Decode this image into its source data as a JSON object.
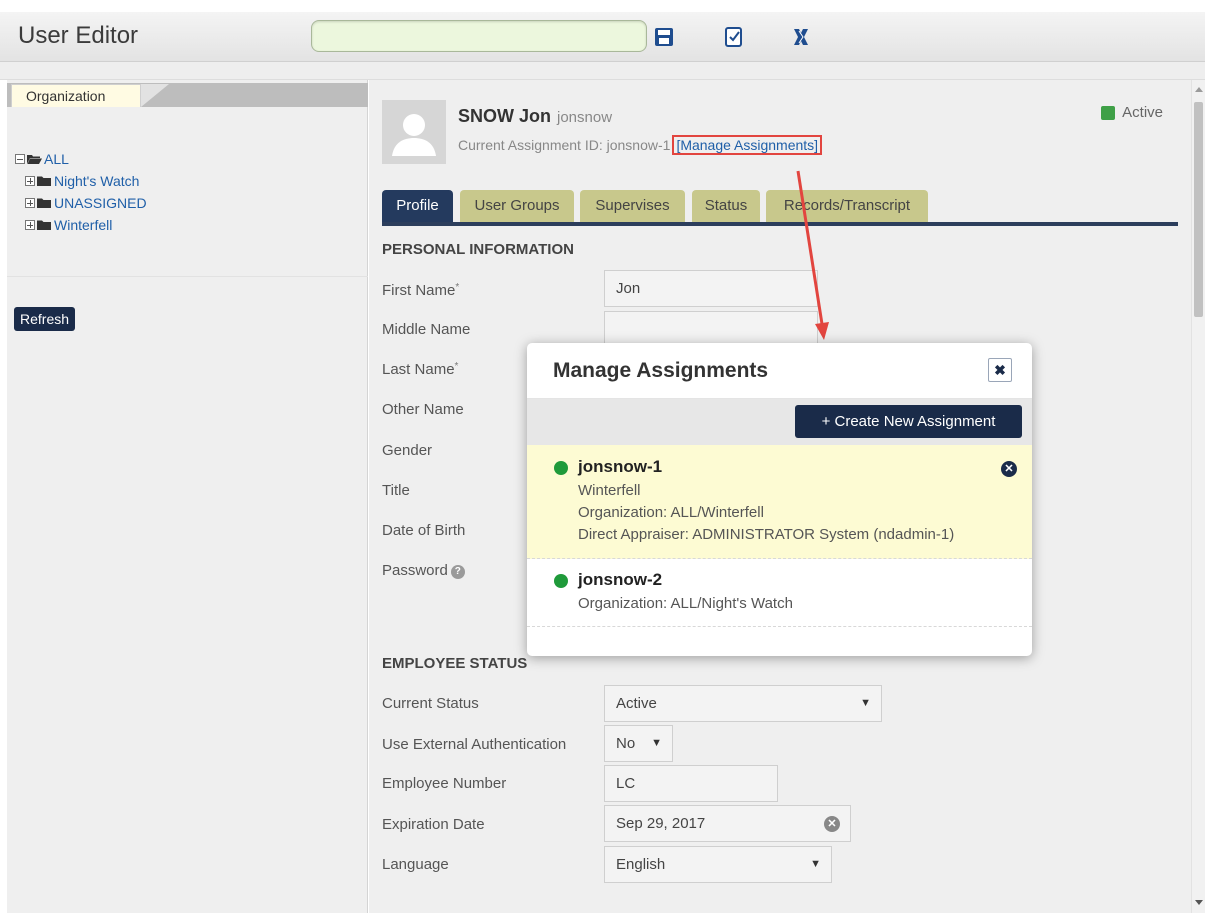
{
  "header": {
    "title": "User Editor",
    "search_value": "",
    "search_placeholder": ""
  },
  "toolbar_icons": [
    "save-icon",
    "edit-document-icon",
    "excel-export-icon"
  ],
  "left_panel": {
    "tab_label": "Organization",
    "tree": [
      {
        "label": "ALL",
        "expanded": true,
        "children": [
          {
            "label": "Night's Watch"
          },
          {
            "label": "UNASSIGNED"
          },
          {
            "label": "Winterfell"
          }
        ]
      }
    ],
    "refresh_label": "Refresh"
  },
  "user": {
    "name": "SNOW Jon",
    "username": "jonsnow",
    "assignment_prefix": "Current Assignment ID: jonsnow-1",
    "manage_link": "[Manage Assignments]",
    "status": "Active",
    "status_color": "#3fa047"
  },
  "tabs": [
    "Profile",
    "User Groups",
    "Supervises",
    "Status",
    "Records/Transcript"
  ],
  "personal": {
    "section_title": "PERSONAL INFORMATION",
    "labels": {
      "first_name": "First Name",
      "middle_name": "Middle Name",
      "last_name": "Last Name",
      "other_name": "Other Name",
      "gender": "Gender",
      "title": "Title",
      "dob": "Date of Birth",
      "password": "Password"
    },
    "required_mark": "*",
    "values": {
      "first_name": "Jon",
      "middle_name": ""
    }
  },
  "employee_status": {
    "section_title": "EMPLOYEE STATUS",
    "labels": {
      "current_status": "Current Status",
      "external_auth": "Use External Authentication",
      "employee_number": "Employee Number",
      "expiration_date": "Expiration Date",
      "language": "Language"
    },
    "values": {
      "current_status": "Active",
      "external_auth": "No",
      "employee_number": "LC",
      "expiration_date": "Sep 29, 2017",
      "language": "English"
    }
  },
  "modal": {
    "title": "Manage Assignments",
    "close_label": "✖",
    "create_label": "+   Create New Assignment",
    "assignments": [
      {
        "id": "jonsnow-1",
        "location": "Winterfell",
        "organization": "Organization: ALL/Winterfell",
        "appraiser": "Direct Appraiser: ADMINISTRATOR System (ndadmin-1)",
        "highlighted": true
      },
      {
        "id": "jonsnow-2",
        "organization": "Organization: ALL/Night's Watch",
        "highlighted": false
      }
    ]
  },
  "colors": {
    "navy": "#1a2b49",
    "tab_inactive": "#c8c88c",
    "highlight_red": "#e2453f",
    "active_green": "#1f9a3a"
  }
}
